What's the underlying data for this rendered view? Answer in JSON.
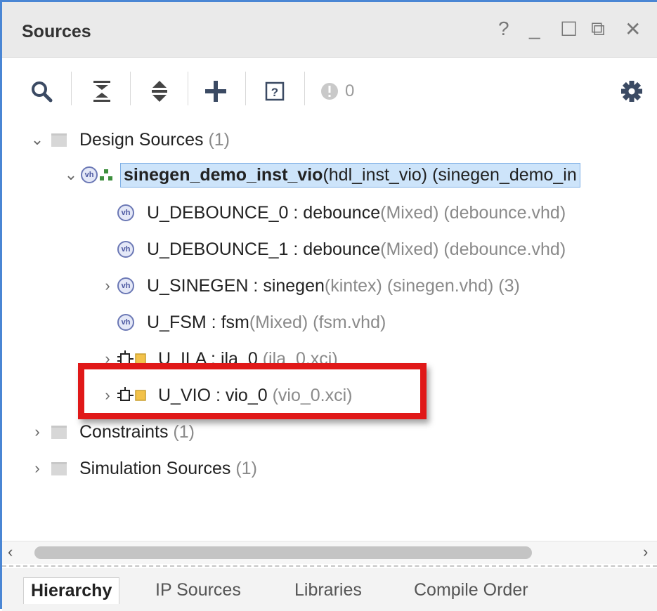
{
  "window": {
    "title": "Sources",
    "controls": [
      "?",
      "_",
      "☐",
      "⧉",
      "✕"
    ]
  },
  "toolbar": {
    "items": [
      "search-icon",
      "collapse-all-icon",
      "expand-all-icon",
      "add-icon",
      "help-icon",
      "warning-icon",
      "settings-icon"
    ],
    "warning_count": "0"
  },
  "tree": {
    "design_sources": {
      "label": "Design Sources",
      "count": "(1)"
    },
    "top": {
      "name": "sinegen_demo_inst_vio",
      "detail": "(hdl_inst_vio) (sinegen_demo_in"
    },
    "children": [
      {
        "name": "U_DEBOUNCE_0 : debounce",
        "lib": "(Mixed)",
        "file": "(debounce.vhd)",
        "suffix": ""
      },
      {
        "name": "U_DEBOUNCE_1 : debounce",
        "lib": "(Mixed)",
        "file": "(debounce.vhd)",
        "suffix": ""
      },
      {
        "name": "U_SINEGEN : sinegen",
        "lib": "(kintex)",
        "file": "(sinegen.vhd)",
        "suffix": "(3)"
      },
      {
        "name": "U_FSM : fsm",
        "lib": "(Mixed)",
        "file": "(fsm.vhd)",
        "suffix": ""
      }
    ],
    "ip": [
      {
        "name": "U_ILA : ila_0",
        "file": "(ila_0.xci)"
      },
      {
        "name": "U_VIO : vio_0",
        "file": "(vio_0.xci)"
      }
    ],
    "constraints": {
      "label": "Constraints",
      "count": "(1)"
    },
    "simulation": {
      "label": "Simulation Sources",
      "count": "(1)"
    }
  },
  "tabs": [
    "Hierarchy",
    "IP Sources",
    "Libraries",
    "Compile Order"
  ],
  "colors": {
    "window_border": "#4a86d4",
    "selection": "#cde4fa",
    "highlight_box": "#e01818"
  }
}
